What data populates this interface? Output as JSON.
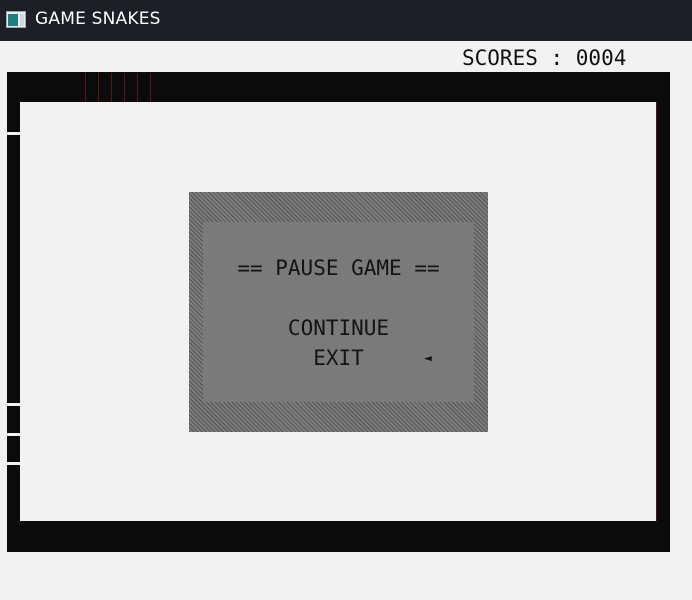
{
  "window": {
    "title": "GAME SNAKES",
    "icon": "app-window-icon"
  },
  "hud": {
    "score_text": "SCORES : 0004"
  },
  "pause_menu": {
    "title": "== PAUSE GAME ==",
    "items": [
      {
        "label": "CONTINUE",
        "selected": false
      },
      {
        "label": "EXIT",
        "selected": true
      }
    ],
    "cursor_glyph": "◄"
  },
  "colors": {
    "titlebar_bg": "#1c1f26",
    "board_border": "#0b0b0b",
    "play_area_bg": "#f2f2f2",
    "dialog_bg": "#7a7a7a",
    "text": "#141414"
  }
}
